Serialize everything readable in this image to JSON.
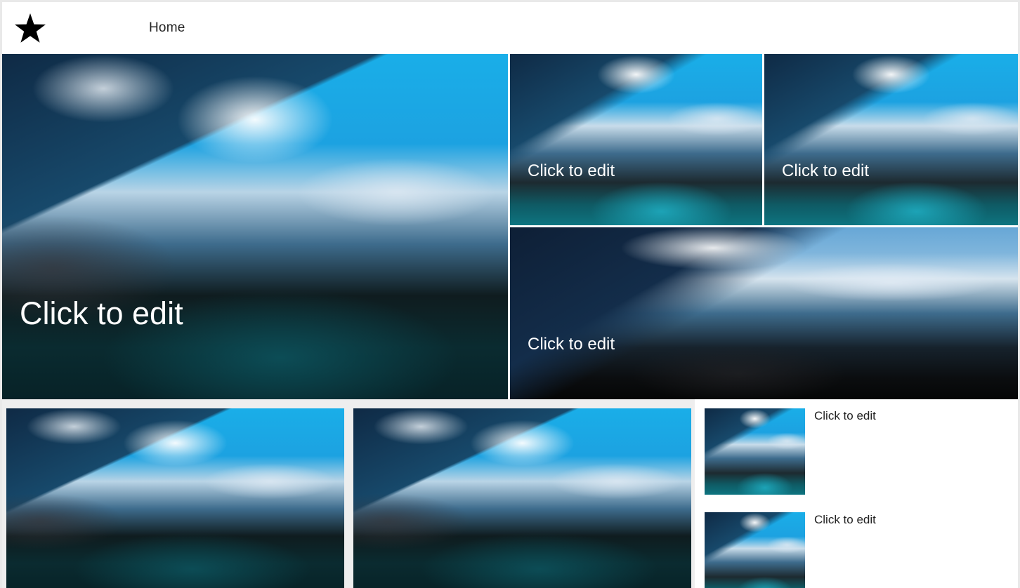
{
  "navbar": {
    "logo_icon": "star-icon",
    "home_label": "Home"
  },
  "hero": {
    "main_caption": "Click to edit",
    "top_left_caption": "Click to edit",
    "top_right_caption": "Click to edit",
    "wide_caption": "Click to edit"
  },
  "side_list": {
    "items": [
      {
        "caption": "Click to edit"
      },
      {
        "caption": "Click to edit"
      }
    ]
  },
  "colors": {
    "background": "#ffffff",
    "page_outer": "#e9e9e9",
    "bottom_section_bg": "#eeeeee",
    "caption_text": "#ffffff",
    "body_text": "#222222"
  }
}
